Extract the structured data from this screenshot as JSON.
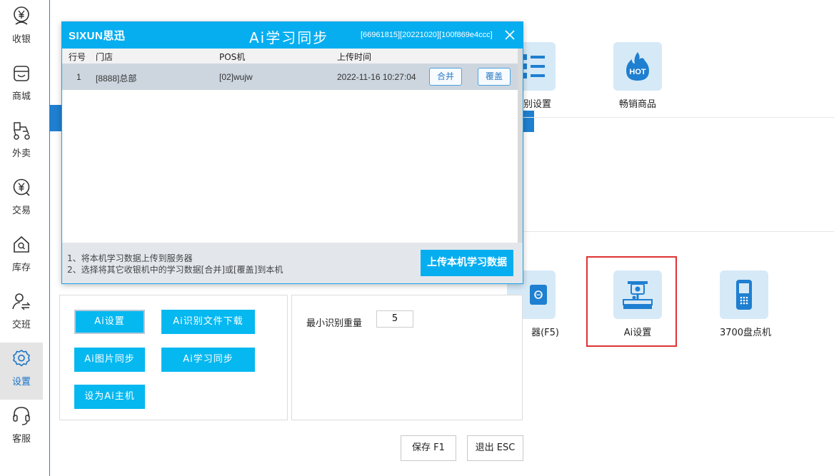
{
  "sidebar": {
    "items": [
      {
        "label": "收银",
        "icon": "cashier-yen-icon"
      },
      {
        "label": "商城",
        "icon": "shop-icon"
      },
      {
        "label": "外卖",
        "icon": "delivery-scooter-icon"
      },
      {
        "label": "交易",
        "icon": "transaction-yen-icon"
      },
      {
        "label": "库存",
        "icon": "inventory-house-icon"
      },
      {
        "label": "交班",
        "icon": "shift-handover-icon"
      },
      {
        "label": "设置",
        "icon": "settings-gear-icon"
      },
      {
        "label": "客服",
        "icon": "headset-icon"
      }
    ],
    "active_index": 6
  },
  "grid": {
    "top_row": [
      {
        "label": "别设置",
        "icon": "list-icon"
      },
      {
        "label": "畅销商品",
        "icon": "hot-icon"
      }
    ],
    "second_row": [
      {
        "label": "器(F5)",
        "icon": "scanner-icon"
      },
      {
        "label": "Ai设置",
        "icon": "ai-scale-icon"
      },
      {
        "label": "3700盘点机",
        "icon": "handheld-device-icon"
      }
    ]
  },
  "settings": {
    "buttons": {
      "ai_settings": "Ai设置",
      "ai_file_download": "Ai识别文件下载",
      "ai_image_sync": "Ai图片同步",
      "ai_learn_sync": "Ai学习同步",
      "set_ai_host": "设为Ai主机"
    },
    "min_weight_label": "最小识别重量",
    "min_weight_value": "5",
    "save_label": "保存 F1",
    "exit_label": "退出 ESC"
  },
  "dialog": {
    "logo": "SIXUN思迅",
    "title": "Ai学习同步",
    "meta": "[66961815][20221020][100f869e4ccc]",
    "columns": [
      "行号",
      "门店",
      "POS机",
      "上传时间"
    ],
    "rows": [
      {
        "row_no": "1",
        "store": "[8888]总部",
        "pos": "[02]wujw",
        "upload_time": "2022-11-16 10:27:04",
        "merge_label": "合并",
        "overwrite_label": "覆盖"
      }
    ],
    "footer_note_1": "1、将本机学习数据上传到服务器",
    "footer_note_2": "2、选择将其它收银机中的学习数据[合并]或[覆盖]到本机",
    "upload_button": "上传本机学习数据"
  },
  "colors": {
    "accent": "#06aef0",
    "cyan_button": "#06b8f0",
    "tile_bg": "#d6e9f7",
    "icon_blue": "#1f7fd0",
    "highlight": "#dd3333"
  }
}
